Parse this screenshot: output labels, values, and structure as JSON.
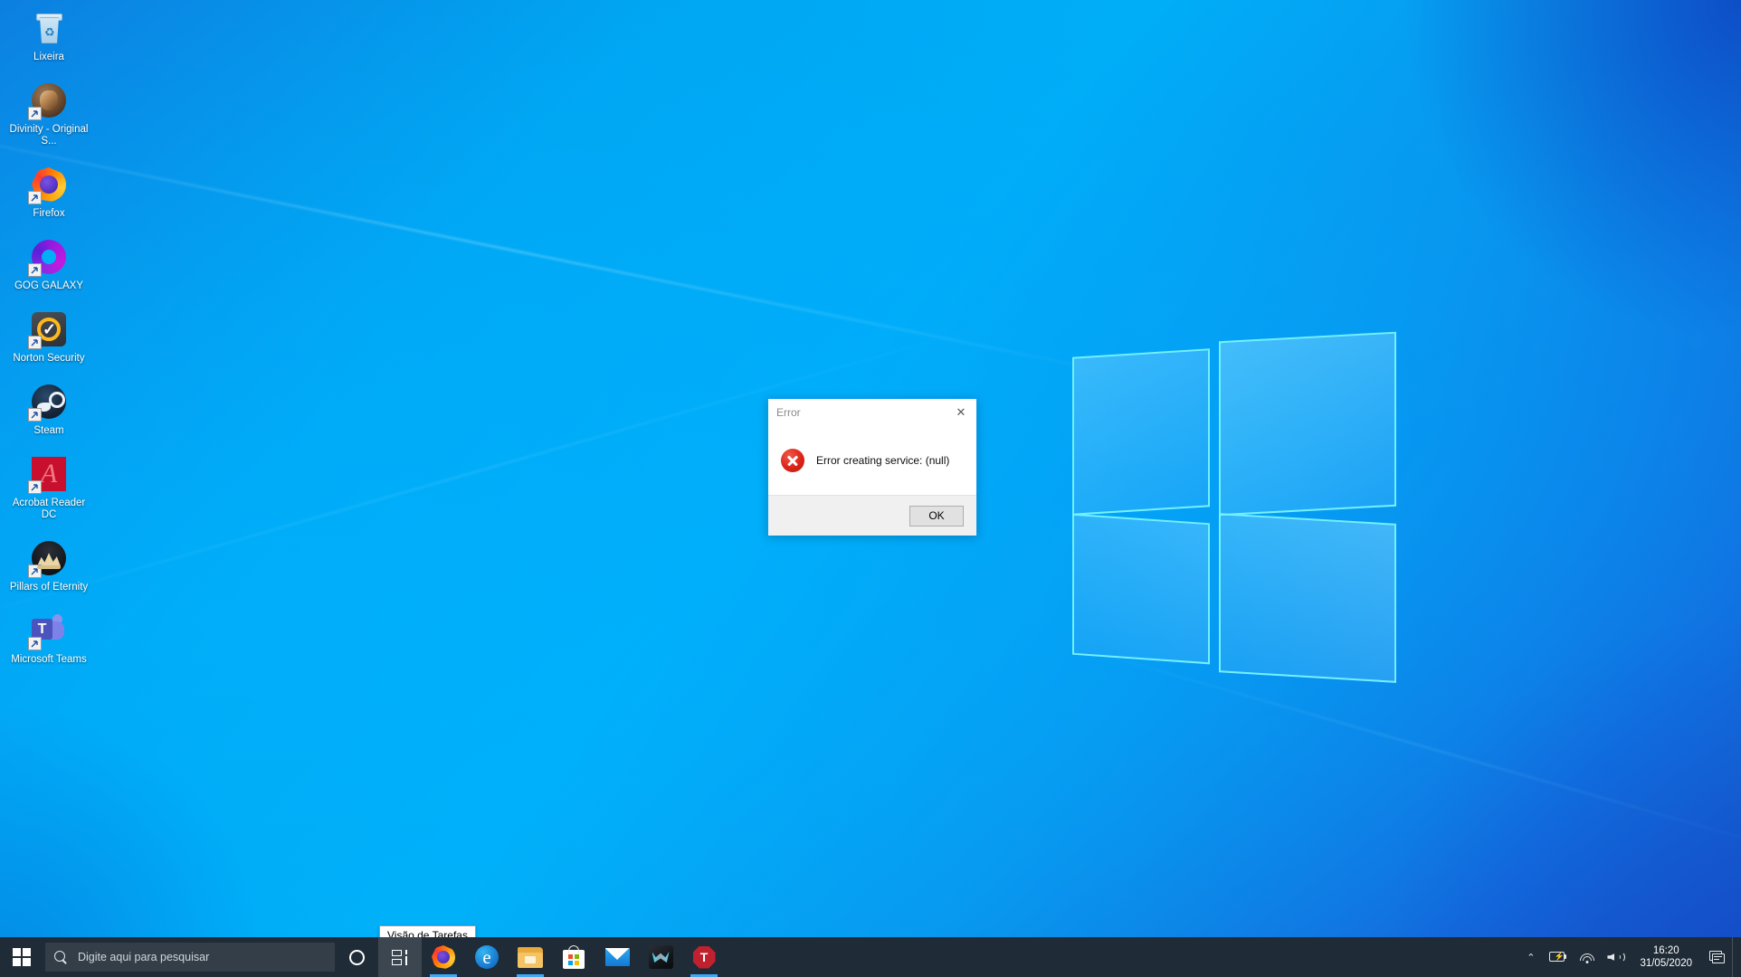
{
  "desktop": {
    "wallpaper_name": "windows-10-hero-light",
    "colors": {
      "wallpaper_primary": "#00aff7",
      "wallpaper_deep": "#1b4fc4",
      "taskbar": "#1f2b36",
      "accent": "#3fa9f5",
      "error_red": "#dc2418"
    },
    "icons": [
      {
        "label": "Lixeira",
        "icon": "recycle-bin-icon",
        "shortcut": false
      },
      {
        "label": "Divinity - Original S...",
        "icon": "divinity-original-sin-icon",
        "shortcut": true
      },
      {
        "label": "Firefox",
        "icon": "firefox-icon",
        "shortcut": true
      },
      {
        "label": "GOG GALAXY",
        "icon": "gog-galaxy-icon",
        "shortcut": true
      },
      {
        "label": "Norton Security",
        "icon": "norton-security-icon",
        "shortcut": true
      },
      {
        "label": "Steam",
        "icon": "steam-icon",
        "shortcut": true
      },
      {
        "label": "Acrobat Reader DC",
        "icon": "acrobat-reader-icon",
        "shortcut": true
      },
      {
        "label": "Pillars of Eternity",
        "icon": "pillars-of-eternity-icon",
        "shortcut": true
      },
      {
        "label": "Microsoft Teams",
        "icon": "microsoft-teams-icon",
        "shortcut": true
      }
    ]
  },
  "dialog": {
    "title": "Error",
    "close_glyph": "✕",
    "message": "Error creating service: (null)",
    "icon": "error-circle-icon",
    "ok_label": "OK"
  },
  "tooltip": {
    "text": "Visão de Tarefas"
  },
  "taskbar": {
    "start_label": "Iniciar",
    "search": {
      "placeholder": "Digite aqui para pesquisar",
      "icon": "search-icon"
    },
    "buttons": [
      {
        "name": "cortana",
        "icon": "cortana-circle-icon",
        "running": false
      },
      {
        "name": "task-view",
        "icon": "task-view-icon",
        "running": false
      },
      {
        "name": "firefox",
        "icon": "firefox-icon",
        "running": true
      },
      {
        "name": "microsoft-edge",
        "icon": "edge-icon",
        "running": false
      },
      {
        "name": "file-explorer",
        "icon": "folder-icon",
        "running": true
      },
      {
        "name": "microsoft-store",
        "icon": "store-bag-icon",
        "running": false
      },
      {
        "name": "mail",
        "icon": "mail-envelope-icon",
        "running": false
      },
      {
        "name": "predator-sense",
        "icon": "predator-icon",
        "running": false
      },
      {
        "name": "teamviewer",
        "icon": "red-octagon-t-icon",
        "running": true
      }
    ],
    "tray": {
      "chevron": "⌃",
      "battery_icon": "battery-charging-icon",
      "wifi_icon": "wifi-icon",
      "volume_icon": "volume-icon",
      "time": "16:20",
      "date": "31/05/2020",
      "action_center_icon": "action-center-icon"
    }
  }
}
